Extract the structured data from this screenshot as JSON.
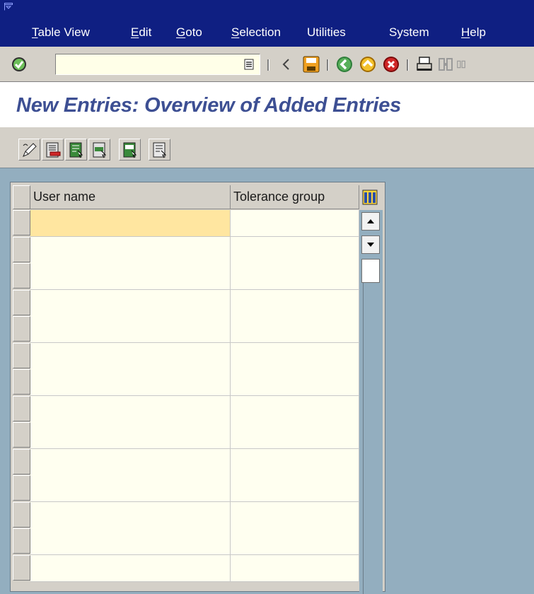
{
  "menubar": {
    "items": [
      {
        "label": "Table View",
        "accel": "T"
      },
      {
        "label": "Edit",
        "accel": "E"
      },
      {
        "label": "Goto",
        "accel": "G"
      },
      {
        "label": "Selection",
        "accel": "S"
      },
      {
        "label": "Utilities",
        "accel": "U"
      },
      {
        "label": "System",
        "accel": "y"
      },
      {
        "label": "Help",
        "accel": "H"
      }
    ]
  },
  "toolbar": {
    "command_field": {
      "value": "",
      "placeholder": ""
    },
    "buttons": [
      "enter-icon",
      "back-nav-icon",
      "save-icon",
      "back-icon",
      "exit-icon",
      "cancel-icon",
      "print-icon",
      "find-icon",
      "find-next-icon"
    ]
  },
  "page": {
    "title": "New Entries: Overview of Added Entries"
  },
  "app_toolbar": {
    "buttons": [
      "change-display-icon",
      "delete-row-icon",
      "select-all-icon",
      "select-block-icon",
      "deselect-all-icon"
    ]
  },
  "table": {
    "columns": [
      "User name",
      "Tolerance group"
    ],
    "rows": [
      {
        "user_name": "",
        "tolerance_group": ""
      },
      {
        "user_name": "",
        "tolerance_group": ""
      },
      {
        "user_name": "",
        "tolerance_group": ""
      },
      {
        "user_name": "",
        "tolerance_group": ""
      },
      {
        "user_name": "",
        "tolerance_group": ""
      },
      {
        "user_name": "",
        "tolerance_group": ""
      },
      {
        "user_name": "",
        "tolerance_group": ""
      },
      {
        "user_name": "",
        "tolerance_group": ""
      },
      {
        "user_name": "",
        "tolerance_group": ""
      },
      {
        "user_name": "",
        "tolerance_group": ""
      },
      {
        "user_name": "",
        "tolerance_group": ""
      },
      {
        "user_name": "",
        "tolerance_group": ""
      },
      {
        "user_name": "",
        "tolerance_group": ""
      },
      {
        "user_name": "",
        "tolerance_group": ""
      }
    ]
  },
  "colors": {
    "menubar_bg": "#0f1f82",
    "title_text": "#3d4f93",
    "active_cell": "#ffe6a0",
    "cell_bg": "#fffff0",
    "background": "#93aebf"
  }
}
